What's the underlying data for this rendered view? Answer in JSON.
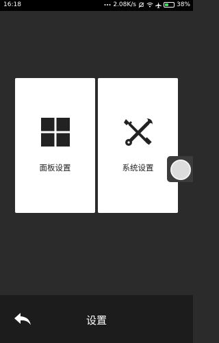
{
  "status_bar": {
    "time": "16:18",
    "network_speed": "2.08K/s",
    "battery_percent": "38%",
    "battery_level": 0.38,
    "icons": [
      "signal-dots-icon",
      "data-speed-icon",
      "mute-icon",
      "wifi-icon",
      "airplane-icon",
      "battery-icon"
    ]
  },
  "cards": [
    {
      "label": "面板设置",
      "icon": "grid-icon"
    },
    {
      "label": "系统设置",
      "icon": "tools-icon"
    }
  ],
  "floating_handle": {
    "icon": "assistive-touch-icon"
  },
  "bottom_bar": {
    "title": "设置",
    "back_icon": "back-arrow-icon"
  },
  "colors": {
    "background": "#2b2b2b",
    "card": "#ffffff",
    "bottom_bar": "#1c1c1c",
    "battery": "#4cd964"
  }
}
